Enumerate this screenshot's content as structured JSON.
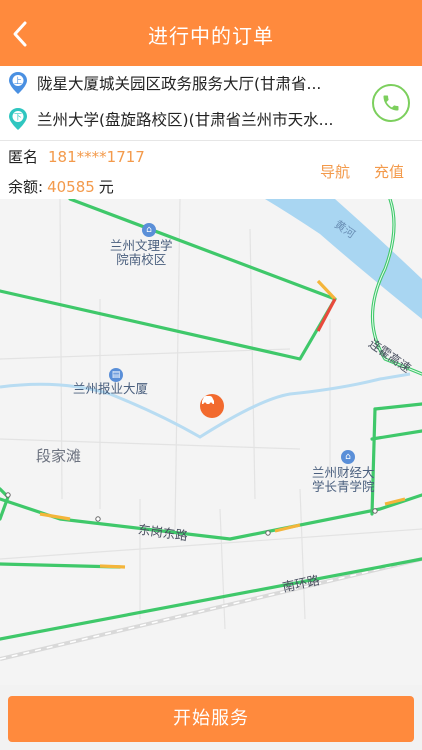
{
  "header": {
    "title": "进行中的订单"
  },
  "trip": {
    "pickup_badge": "上",
    "dropoff_badge": "下",
    "pickup": "陇星大厦城关园区政务服务大厅(甘肃省...",
    "dropoff": "兰州大学(盘旋路校区)(甘肃省兰州市天水..."
  },
  "passenger": {
    "name": "匿名",
    "phone": "181****1717",
    "balance_label": "余额:",
    "balance_value": "40585",
    "balance_unit": "元"
  },
  "actions": {
    "navigate": "导航",
    "recharge": "充值"
  },
  "map": {
    "labels": {
      "wenli_college": "兰州文理学\n院南校区",
      "baoye": "兰州报业大厦",
      "duanjiatan": "段家滩",
      "caijing": "兰州财经大\n学长青学院",
      "donggang_road": "东岗东路",
      "nanhuan_road": "南环路",
      "yellow_river": "黄河",
      "lianhuo_highway": "连霍高速"
    }
  },
  "footer": {
    "start_label": "开始服务"
  },
  "colors": {
    "accent": "#ff8a3d",
    "road_green": "#3fc86a",
    "call_green": "#7ccf5d"
  }
}
